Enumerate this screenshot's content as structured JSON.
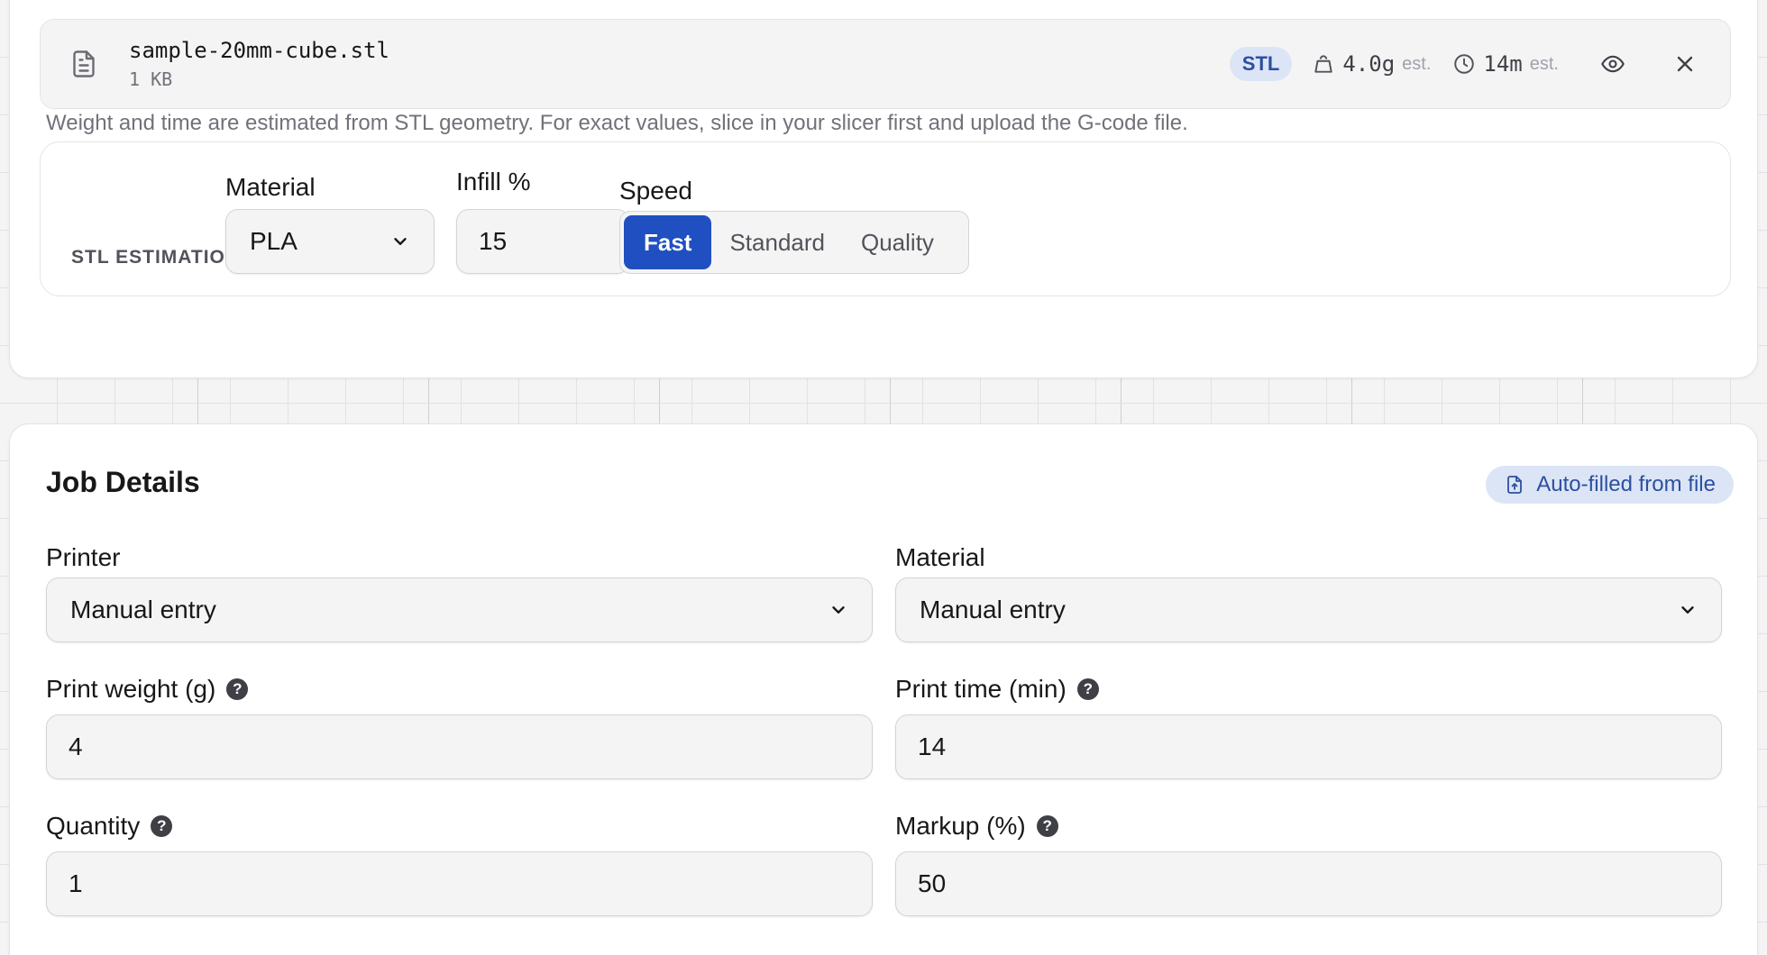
{
  "file": {
    "name": "sample-20mm-cube.stl",
    "size": "1 KB",
    "type_badge": "STL",
    "weight": "4.0g",
    "weight_suffix": "est.",
    "time": "14m",
    "time_suffix": "est."
  },
  "hint": "Weight and time are estimated from STL geometry. For exact values, slice in your slicer first and upload the G-code file.",
  "stl_estimation": {
    "section_label": "STL ESTIMATION",
    "material_label": "Material",
    "material_value": "PLA",
    "infill_label": "Infill %",
    "infill_value": "15",
    "speed_label": "Speed",
    "speed_options": [
      "Fast",
      "Standard",
      "Quality"
    ],
    "speed_selected": "Fast"
  },
  "job": {
    "title": "Job Details",
    "autofill_badge": "Auto-filled from file",
    "printer_label": "Printer",
    "printer_value": "Manual entry",
    "material_label": "Material",
    "material_value": "Manual entry",
    "weight_label": "Print weight (g)",
    "weight_value": "4",
    "time_label": "Print time (min)",
    "time_value": "14",
    "quantity_label": "Quantity",
    "quantity_value": "1",
    "markup_label": "Markup (%)",
    "markup_value": "50",
    "help_glyph": "?"
  },
  "colors": {
    "accent": "#1f4fc0",
    "badge_bg": "#dbe5f6",
    "badge_text": "#2d4f9e"
  }
}
